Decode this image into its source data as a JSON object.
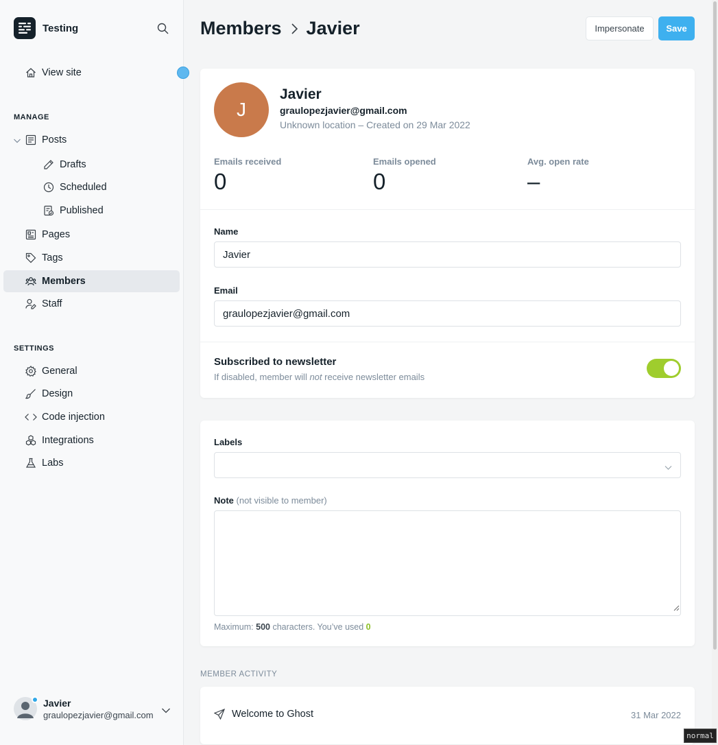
{
  "brand": {
    "name": "Testing"
  },
  "sidebar": {
    "view_site": "View site",
    "manage_title": "MANAGE",
    "settings_title": "SETTINGS",
    "items": {
      "posts": "Posts",
      "drafts": "Drafts",
      "scheduled": "Scheduled",
      "published": "Published",
      "pages": "Pages",
      "tags": "Tags",
      "members": "Members",
      "staff": "Staff",
      "general": "General",
      "design": "Design",
      "code_injection": "Code injection",
      "integrations": "Integrations",
      "labs": "Labs"
    },
    "user": {
      "name": "Javier",
      "email": "graulopezjavier@gmail.com"
    }
  },
  "header": {
    "breadcrumb_parent": "Members",
    "breadcrumb_current": "Javier",
    "impersonate_label": "Impersonate",
    "save_label": "Save"
  },
  "member": {
    "initial": "J",
    "name": "Javier",
    "email": "graulopezjavier@gmail.com",
    "meta": "Unknown location – Created on 29 Mar 2022"
  },
  "stats": [
    {
      "label": "Emails received",
      "value": "0"
    },
    {
      "label": "Emails opened",
      "value": "0"
    },
    {
      "label": "Avg. open rate",
      "value": "–"
    }
  ],
  "form": {
    "name_label": "Name",
    "name_value": "Javier",
    "email_label": "Email",
    "email_value": "graulopezjavier@gmail.com",
    "newsletter_title": "Subscribed to newsletter",
    "newsletter_sub_pre": "If disabled, member will ",
    "newsletter_sub_em": "not",
    "newsletter_sub_post": " receive newsletter emails",
    "newsletter_enabled": true,
    "labels_label": "Labels",
    "note_label": "Note",
    "note_hint": "(not visible to member)",
    "helper_pre": "Maximum: ",
    "helper_max": "500",
    "helper_mid": " characters. You’ve used ",
    "helper_used": "0"
  },
  "activity": {
    "title": "MEMBER ACTIVITY",
    "items": [
      {
        "label": "Welcome to Ghost",
        "date": "31 Mar 2022"
      }
    ]
  },
  "status_mode": "normal",
  "colors": {
    "accent": "#3eb0ef",
    "toggle_on": "#9fcd2d",
    "avatar": "#c97a4b"
  }
}
